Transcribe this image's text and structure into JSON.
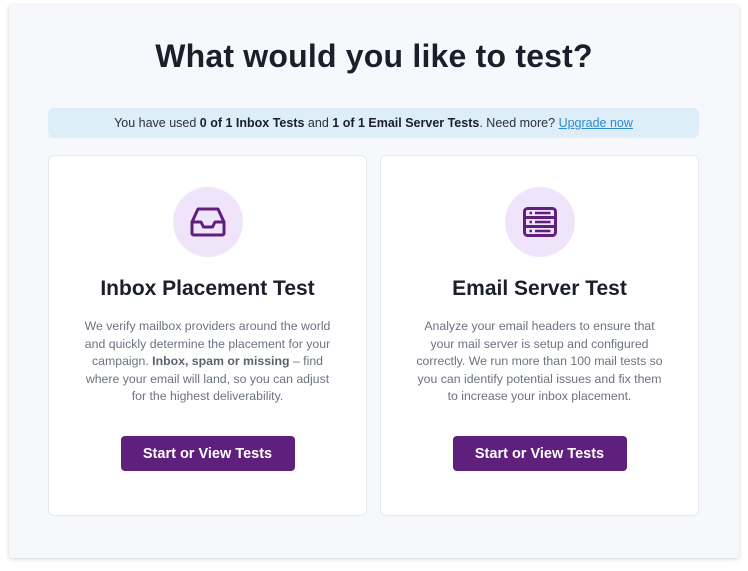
{
  "page": {
    "title": "What would you like to test?"
  },
  "banner": {
    "prefix": "You have used ",
    "inbox_usage": "0 of 1 Inbox Tests",
    "middle": " and ",
    "server_usage": "1 of 1 Email Server Tests",
    "suffix": ". Need more? ",
    "upgrade_link": "Upgrade now"
  },
  "cards": {
    "inbox": {
      "icon": "inbox-tray-icon",
      "title": "Inbox Placement Test",
      "desc_part1": "We verify mailbox providers around the world and quickly determine the placement for your campaign. ",
      "desc_bold": "Inbox, spam or missing",
      "desc_part2": " – find where your email will land, so you can adjust for the highest deliverability.",
      "button": "Start or View Tests"
    },
    "server": {
      "icon": "server-stack-icon",
      "title": "Email Server Test",
      "desc": "Analyze your email headers to ensure that your mail server is setup and configured correctly. We run more than 100 mail tests so you can identify potential issues and fix them to increase your inbox placement.",
      "button": "Start or View Tests"
    }
  },
  "colors": {
    "accent": "#5e1f7d",
    "icon_bg": "#f0e4fb",
    "banner_bg": "#deeef8",
    "link": "#2c8ad0"
  }
}
